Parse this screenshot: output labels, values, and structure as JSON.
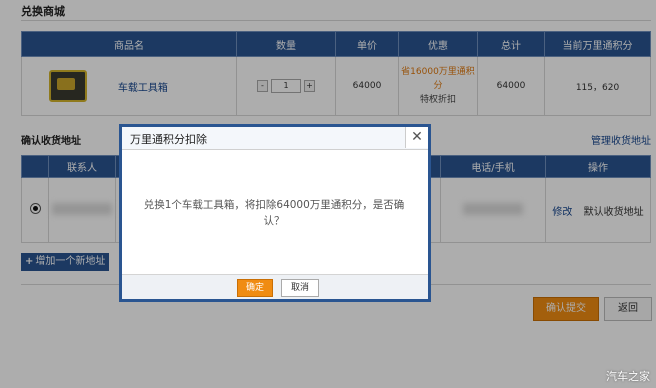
{
  "page": {
    "title": "兑换商城"
  },
  "product_table": {
    "headers": [
      "商品名",
      "数量",
      "单价",
      "优惠",
      "总计",
      "当前万里通积分"
    ],
    "row": {
      "name": "车载工具箱",
      "qty_minus": "-",
      "qty": "1",
      "qty_plus": "+",
      "unit_price": "64000",
      "discount_line1": "省16000万里通积",
      "discount_line2": "分",
      "discount_line3": "特权折扣",
      "total": "64000",
      "points": "115，620"
    }
  },
  "address": {
    "section_title": "确认收货地址",
    "manage_link": "管理收货地址",
    "headers": [
      "",
      "联系人",
      "",
      "电话/手机",
      "操作"
    ],
    "row": {
      "edit": "修改",
      "set_default": "默认收货地址"
    },
    "add_button": "增加一个新地址"
  },
  "actions": {
    "confirm_submit": "确认提交",
    "back": "返回"
  },
  "dialog": {
    "title": "万里通积分扣除",
    "close_glyph": "✕",
    "message": "兑换1个车载工具箱，将扣除64000万里通积分，是否确认？",
    "ok": "确定",
    "cancel": "取消"
  },
  "watermark": "汽车之家",
  "colors": {
    "header_blue": "#2a5591",
    "accent_orange": "#f08c12",
    "discount_orange": "#e07a10"
  },
  "icons": [
    "toolbox-product-image",
    "plus-icon",
    "radio-selected-icon",
    "close-icon"
  ]
}
